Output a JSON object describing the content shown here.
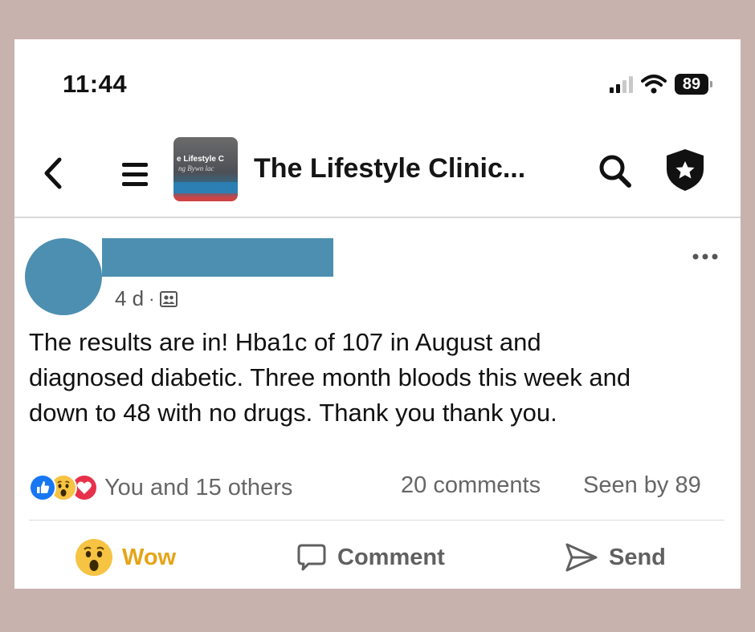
{
  "status_bar": {
    "time": "11:44",
    "battery": "89"
  },
  "nav": {
    "group_title": "The Lifestyle Clinic...",
    "group_thumb_line1": "e Lifestyle C",
    "group_thumb_line2": "ng Bywn lac"
  },
  "post": {
    "meta_time": "4 d",
    "meta_separator": "·",
    "text_lines": [
      "The results are in!  Hba1c of 107 in August and",
      "diagnosed diabetic.  Three month bloods this week and",
      "down to 48 with no drugs.  Thank you thank you."
    ],
    "reactions_summary": "You and 15 others",
    "comments_count": "20 comments",
    "seen_by": "Seen by 89"
  },
  "actions": {
    "reaction_label": "Wow",
    "comment_label": "Comment",
    "send_label": "Send"
  },
  "colors": {
    "background": "#c8b2ae",
    "redaction": "#4d8fb1",
    "wow_yellow": "#e6a417",
    "like_blue": "#1877f2",
    "love_red": "#e7304a"
  },
  "icons": [
    "back-chevron-icon",
    "menu-icon",
    "search-icon",
    "shield-star-icon",
    "more-icon",
    "group-members-icon",
    "like-reaction-icon",
    "wow-reaction-icon",
    "love-reaction-icon",
    "comment-icon",
    "send-icon"
  ]
}
